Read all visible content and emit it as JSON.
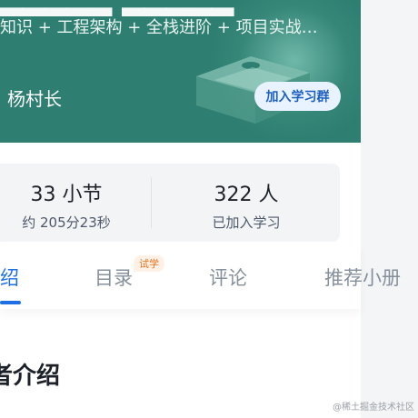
{
  "banner": {
    "subtitle": "知识 + 工程架构 + 全栈进阶 + 项目实战…",
    "author": "杨村长",
    "join_button": "加入学习群",
    "colors": {
      "background": "#2e7f71",
      "button_bg": "#e8f3ff",
      "button_text": "#1e5fc2"
    }
  },
  "stats": {
    "sections": {
      "value": "33 小节",
      "sub": "约 205分23秒"
    },
    "learners": {
      "value": "322 人",
      "sub": "已加入学习"
    }
  },
  "tabs": {
    "items": [
      {
        "label": "绍",
        "active": true
      },
      {
        "label": "目录",
        "badge": "试学"
      },
      {
        "label": "评论"
      },
      {
        "label": "推荐小册"
      }
    ],
    "active_color": "#1e6fe5"
  },
  "content": {
    "section_title": "者介绍"
  },
  "watermark": "@稀土掘金技术社区"
}
